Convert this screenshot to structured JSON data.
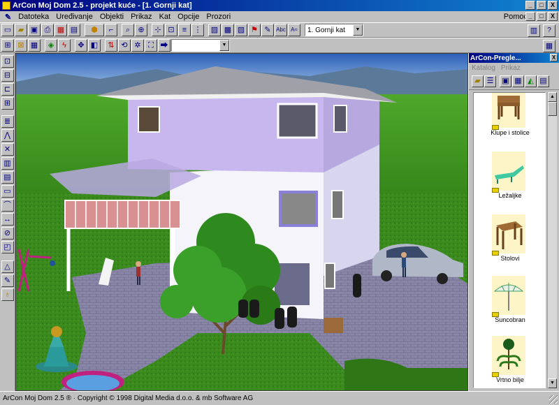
{
  "window": {
    "title": "ArCon Moj Dom  2.5 - projekt kuće - [1. Gornji kat]",
    "buttons": [
      "_",
      "□",
      "X"
    ]
  },
  "menu": {
    "items": [
      "Datoteka",
      "Uređivanje",
      "Objekti",
      "Prikaz",
      "Kat",
      "Opcije",
      "Prozori"
    ],
    "help": "Pomoć"
  },
  "toolbar1": {
    "floor_select": "1. Gornji kat"
  },
  "toolbar2": {
    "empty_select": ""
  },
  "panel": {
    "title": "ArCon-Preglе...",
    "menu": [
      "Katalog",
      "Prikaz"
    ],
    "items": [
      {
        "label": "Klupe i stolice",
        "icon": "bench-icon"
      },
      {
        "label": "Ležaljke",
        "icon": "lounger-icon"
      },
      {
        "label": "Stolovi",
        "icon": "table-icon"
      },
      {
        "label": "Suncobran",
        "icon": "parasol-icon"
      },
      {
        "label": "Vrtno bilje",
        "icon": "garden-plant-icon"
      }
    ]
  },
  "statusbar": {
    "text": "ArCon Moj Dom 2.5 ® · Copyright © 1998 Digital Media d.o.o. & mb Software AG"
  }
}
